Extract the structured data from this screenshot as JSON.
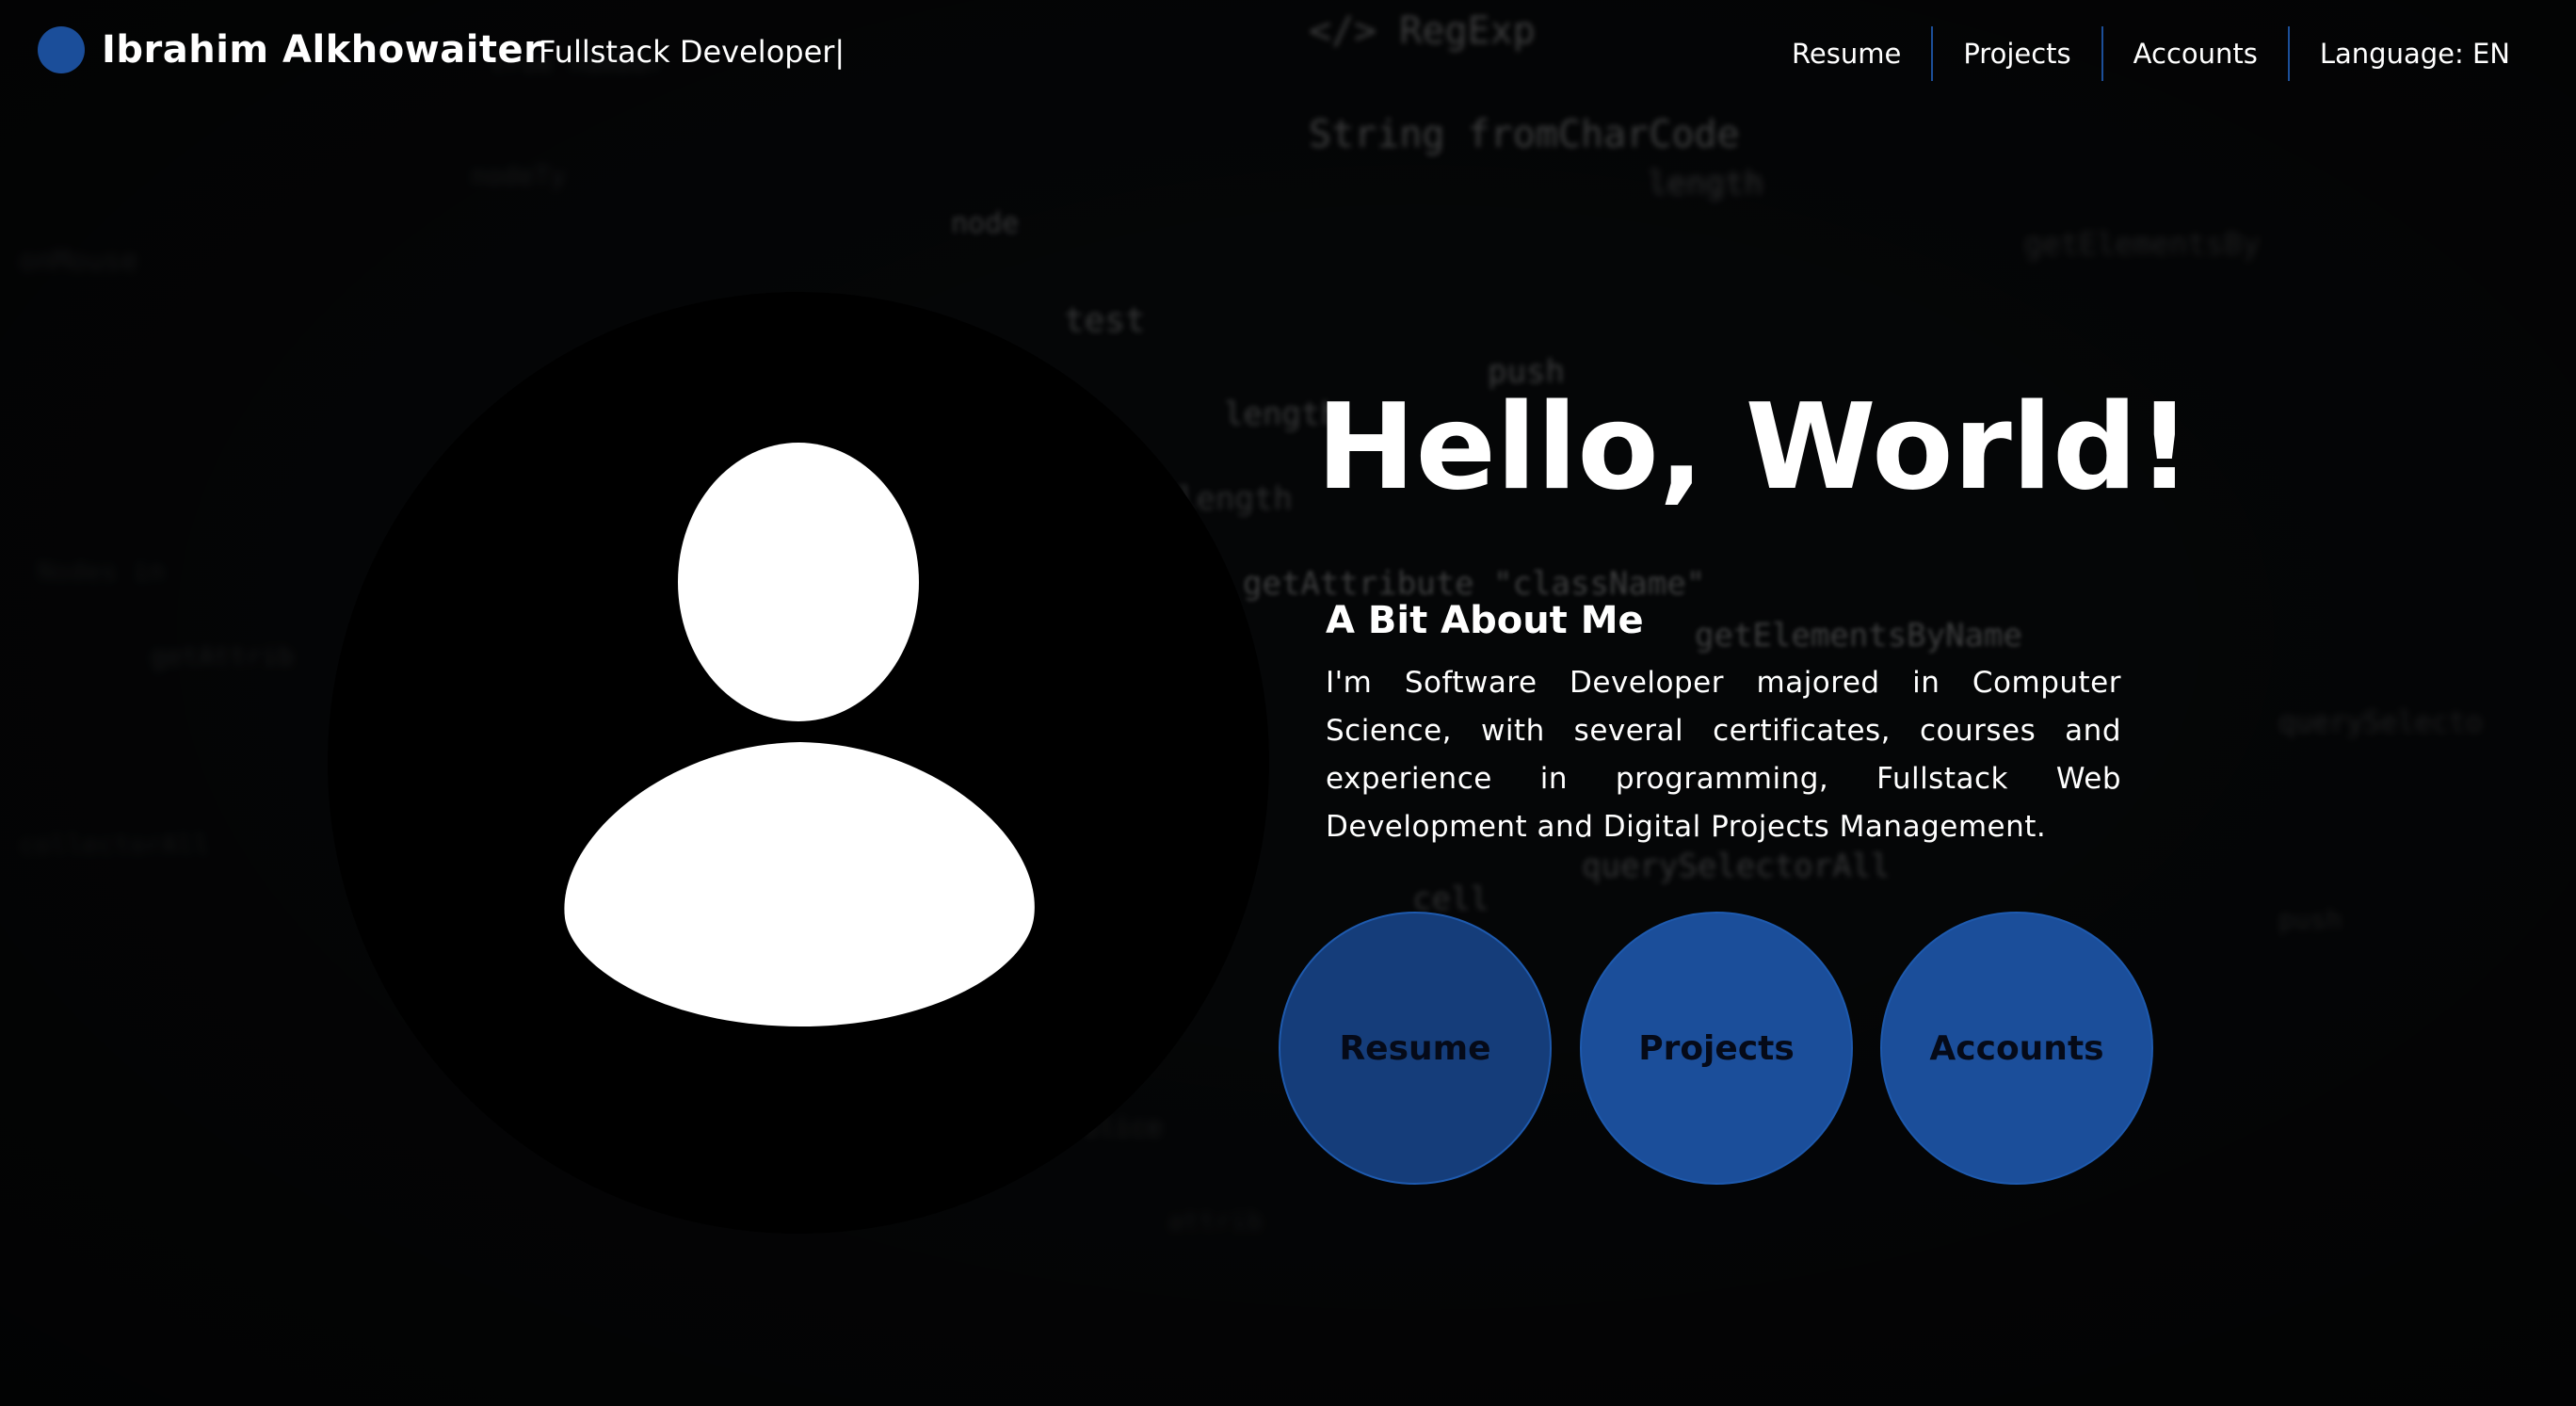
{
  "header": {
    "name": "Ibrahim Alkhowaiter",
    "role": "Fullstack Developer|",
    "nav": [
      "Resume",
      "Projects",
      "Accounts",
      "Language: EN"
    ]
  },
  "hero": {
    "title": "Hello, World!",
    "about_title": "A Bit About Me",
    "about_text": "I'm Software Developer majored in Computer Science, with several certificates, courses and experience in programming, Fullstack Web Development and Digital Projects Management."
  },
  "buttons": [
    "Resume",
    "Projects",
    "Accounts"
  ],
  "colors": {
    "accent": "#1b4e9a",
    "background": "#050607",
    "text": "#ffffff"
  },
  "icons": {
    "logo": "logo-dot-icon",
    "avatar": "user-silhouette-icon"
  }
}
